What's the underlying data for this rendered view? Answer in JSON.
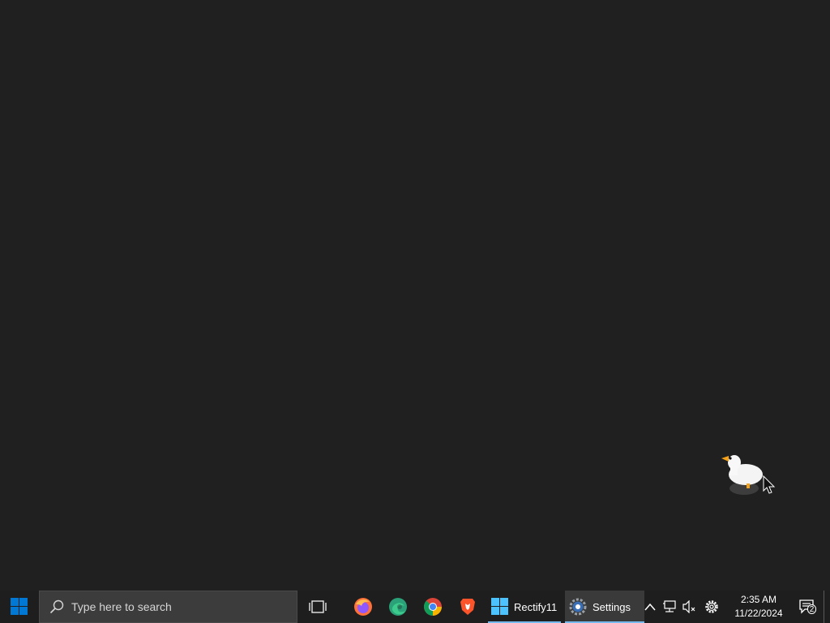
{
  "taskbar": {
    "search_placeholder": "Type here to search",
    "pinned": [
      {
        "name": "firefox-icon"
      },
      {
        "name": "edge-icon"
      },
      {
        "name": "chrome-icon"
      },
      {
        "name": "brave-icon"
      }
    ],
    "open_apps": [
      {
        "label": "Rectify11",
        "icon": "windows-logo-icon",
        "active": false
      },
      {
        "label": "Settings",
        "icon": "gear-icon",
        "active": true
      }
    ],
    "clock": {
      "time": "2:35 AM",
      "date": "11/22/2024"
    },
    "notification_count": "2"
  },
  "colors": {
    "desktop": "#202020",
    "taskbar": "#1e1e1e",
    "accent": "#76b9ed",
    "start_blue": "#0078d4"
  }
}
